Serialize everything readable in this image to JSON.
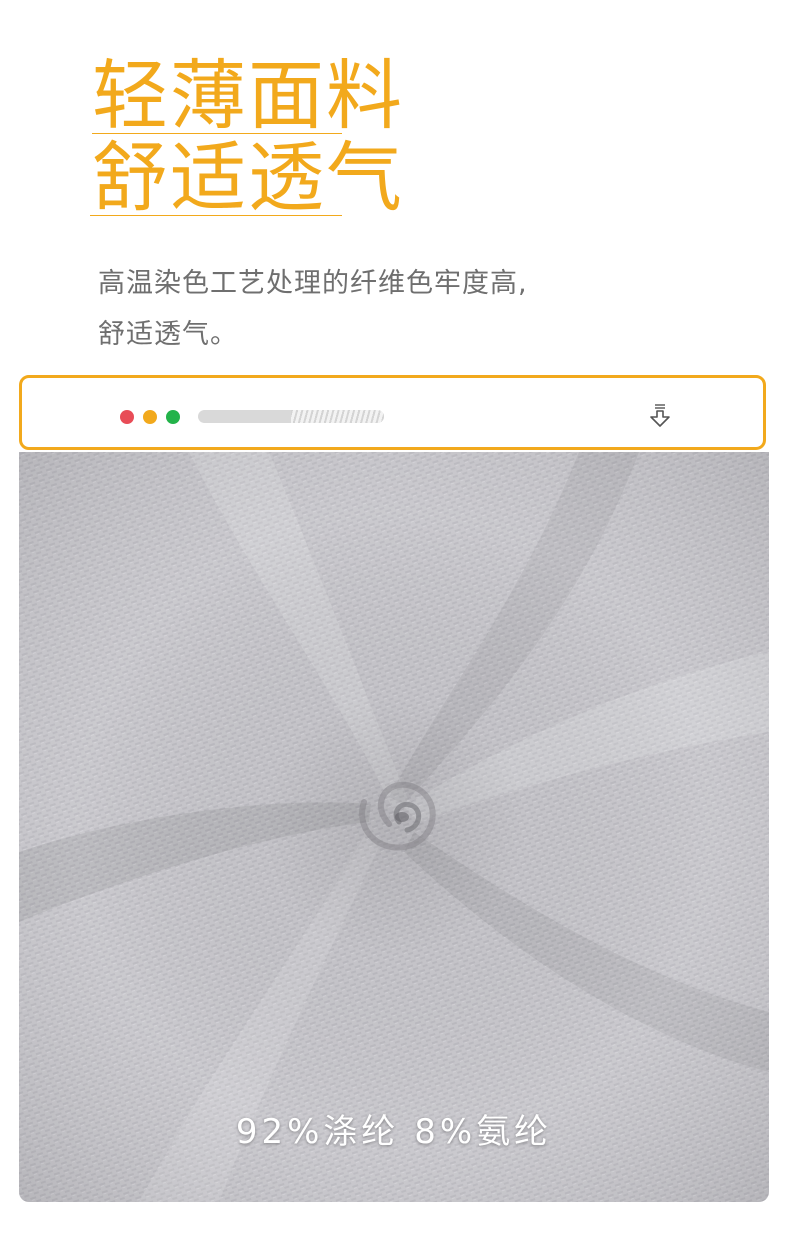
{
  "headline": {
    "line1": "轻薄面料",
    "line2": "舒适透气"
  },
  "description": {
    "line1": "高温染色工艺处理的纤维色牢度高,",
    "line2": "舒适透气。"
  },
  "browser_bar": {
    "dots": [
      {
        "name": "close",
        "color": "#e84c57"
      },
      {
        "name": "minimize",
        "color": "#f2a91c"
      },
      {
        "name": "maximize",
        "color": "#23b34a"
      }
    ],
    "progress": 0.5,
    "icon": "download-icon"
  },
  "fabric": {
    "caption": "92%涤纶 8%氨纶"
  },
  "colors": {
    "accent": "#f2a91c",
    "description_text": "#6f6f6f",
    "fabric_base": "#c8c7cc"
  }
}
